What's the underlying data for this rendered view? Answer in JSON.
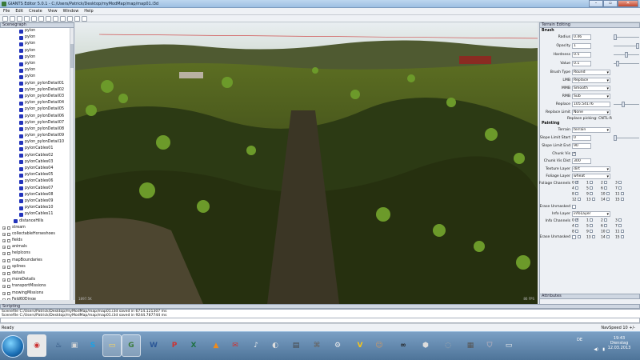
{
  "window": {
    "title": "GIANTS Editor 5.0.1 - C:/Users/Patrick/Desktop/myModMap/map/map01.i3d"
  },
  "menu": [
    "File",
    "Edit",
    "Create",
    "View",
    "Window",
    "Help"
  ],
  "panels": {
    "scenegraph": "Scenegraph",
    "terrain": "Terrain Editing",
    "attributes": "Attributes",
    "scripting": "Scripting"
  },
  "scenegraph": {
    "items": [
      {
        "label": "pylon",
        "indent": 3,
        "icon": "mesh"
      },
      {
        "label": "pylon",
        "indent": 3,
        "icon": "mesh"
      },
      {
        "label": "pylon",
        "indent": 3,
        "icon": "mesh"
      },
      {
        "label": "pylon",
        "indent": 3,
        "icon": "mesh"
      },
      {
        "label": "pylon",
        "indent": 3,
        "icon": "mesh"
      },
      {
        "label": "pylon",
        "indent": 3,
        "icon": "mesh"
      },
      {
        "label": "pylon",
        "indent": 3,
        "icon": "mesh"
      },
      {
        "label": "pylon",
        "indent": 3,
        "icon": "mesh"
      },
      {
        "label": "pylon_pylonDetail01",
        "indent": 3,
        "icon": "mesh"
      },
      {
        "label": "pylon_pylonDetail02",
        "indent": 3,
        "icon": "mesh"
      },
      {
        "label": "pylon_pylonDetail03",
        "indent": 3,
        "icon": "mesh"
      },
      {
        "label": "pylon_pylonDetail04",
        "indent": 3,
        "icon": "mesh"
      },
      {
        "label": "pylon_pylonDetail05",
        "indent": 3,
        "icon": "mesh"
      },
      {
        "label": "pylon_pylonDetail06",
        "indent": 3,
        "icon": "mesh"
      },
      {
        "label": "pylon_pylonDetail07",
        "indent": 3,
        "icon": "mesh"
      },
      {
        "label": "pylon_pylonDetail08",
        "indent": 3,
        "icon": "mesh"
      },
      {
        "label": "pylon_pylonDetail09",
        "indent": 3,
        "icon": "mesh"
      },
      {
        "label": "pylon_pylonDetail10",
        "indent": 3,
        "icon": "mesh"
      },
      {
        "label": "pylonCables01",
        "indent": 3,
        "icon": "mesh"
      },
      {
        "label": "pylonCables02",
        "indent": 3,
        "icon": "mesh"
      },
      {
        "label": "pylonCables03",
        "indent": 3,
        "icon": "mesh"
      },
      {
        "label": "pylonCables04",
        "indent": 3,
        "icon": "mesh"
      },
      {
        "label": "pylonCables05",
        "indent": 3,
        "icon": "mesh"
      },
      {
        "label": "pylonCables06",
        "indent": 3,
        "icon": "mesh"
      },
      {
        "label": "pylonCables07",
        "indent": 3,
        "icon": "mesh"
      },
      {
        "label": "pylonCables08",
        "indent": 3,
        "icon": "mesh"
      },
      {
        "label": "pylonCables09",
        "indent": 3,
        "icon": "mesh"
      },
      {
        "label": "pylonCables10",
        "indent": 3,
        "icon": "mesh"
      },
      {
        "label": "pylonCables11",
        "indent": 3,
        "icon": "mesh"
      },
      {
        "label": "distanceHills",
        "indent": 2,
        "icon": "mesh"
      },
      {
        "label": "stream",
        "indent": 0,
        "icon": "tf",
        "expander": "+"
      },
      {
        "label": "collectableHorseshoes",
        "indent": 0,
        "icon": "tf",
        "expander": "+"
      },
      {
        "label": "fields",
        "indent": 0,
        "icon": "tf",
        "expander": "+"
      },
      {
        "label": "animals",
        "indent": 0,
        "icon": "tf",
        "expander": "+"
      },
      {
        "label": "helpIcons",
        "indent": 0,
        "icon": "tf",
        "expander": "+"
      },
      {
        "label": "mapBoundaries",
        "indent": 0,
        "icon": "tf",
        "expander": "+"
      },
      {
        "label": "splines",
        "indent": 0,
        "icon": "tf",
        "expander": "+"
      },
      {
        "label": "details",
        "indent": 0,
        "icon": "tf",
        "expander": "+"
      },
      {
        "label": "moreDetails",
        "indent": 0,
        "icon": "tf",
        "expander": "+"
      },
      {
        "label": "transportMissions",
        "indent": 0,
        "icon": "tf",
        "expander": "+"
      },
      {
        "label": "mowingMissions",
        "indent": 0,
        "icon": "tf",
        "expander": "+"
      },
      {
        "label": "Feld60Dinge",
        "indent": 0,
        "icon": "tf",
        "expander": "-"
      },
      {
        "label": "strohkraftwerk",
        "indent": 1,
        "icon": "tf",
        "expander": "+"
      },
      {
        "label": "poleBarn04",
        "indent": 1,
        "icon": "tf",
        "expander": "+"
      },
      {
        "label": "gasStation",
        "indent": 1,
        "icon": "mesh",
        "expander": "+"
      }
    ]
  },
  "viewport": {
    "left_label": "1897.5K",
    "right_label": "86 FPS"
  },
  "terrain": {
    "brush_title": "Brush",
    "radius_label": "Radius",
    "radius": "0.46",
    "opacity_label": "Opacity",
    "opacity": "1",
    "hardness_label": "Hardness",
    "hardness": "0.5",
    "value_label": "Value",
    "value": "0.1",
    "brushtype_label": "Brush Type",
    "brushtype": "Round",
    "lmb_label": "LMB",
    "lmb": "Replace",
    "mmb_label": "MMB",
    "mmb": "Smooth",
    "rmb_label": "RMB",
    "rmb": "Sub",
    "replace_label": "Replace",
    "replace": "105.54176",
    "replacelimit_label": "Replace Limit",
    "replacelimit": "None",
    "replacepicking": "Replace picking: CNTL-R",
    "painting_title": "Painting",
    "terrain_label": "Terrain",
    "terrain": "terrain",
    "slopestart_label": "Slope Limit Start",
    "slopestart": "0",
    "slopeend_label": "Slope Limit End",
    "slopeend": "90",
    "chunkvis_label": "Chunk Vis",
    "chunkvisdist_label": "Chunk Vis Dist",
    "chunkvisdist": "300",
    "texturelayer_label": "Texture Layer",
    "texturelayer": "dirt",
    "foliagelayer_label": "Foliage Layer",
    "foliagelayer": "wheat",
    "foliagechannels_label": "Foliage Channels",
    "erase_label": "Erase Unmasked",
    "infolayer_label": "Info Layer",
    "infolayer": "infoLayer",
    "infochannels_label": "Info Channels",
    "erase2_label": "Erase Unmasked",
    "channels": [
      "0",
      "1",
      "2",
      "3",
      "4",
      "5",
      "6",
      "7",
      "8",
      "9",
      "10",
      "11",
      "12",
      "13",
      "14",
      "15"
    ]
  },
  "scripting": {
    "lines": [
      "Scenefile C:/Users/Patrick/Desktop/myModMap/map/map01.i3d saved in 6714.121307 ms",
      "Scenefile C:/Users/Patrick/Desktop/myModMap/map/map01.i3d saved in 9244.787744 ms"
    ]
  },
  "status": {
    "left": "Ready",
    "right": "NavSpeed 10 +/-"
  },
  "taskbar": {
    "lang": "DE",
    "time": "19:43",
    "day": "Dienstag",
    "date": "12.03.2013"
  }
}
